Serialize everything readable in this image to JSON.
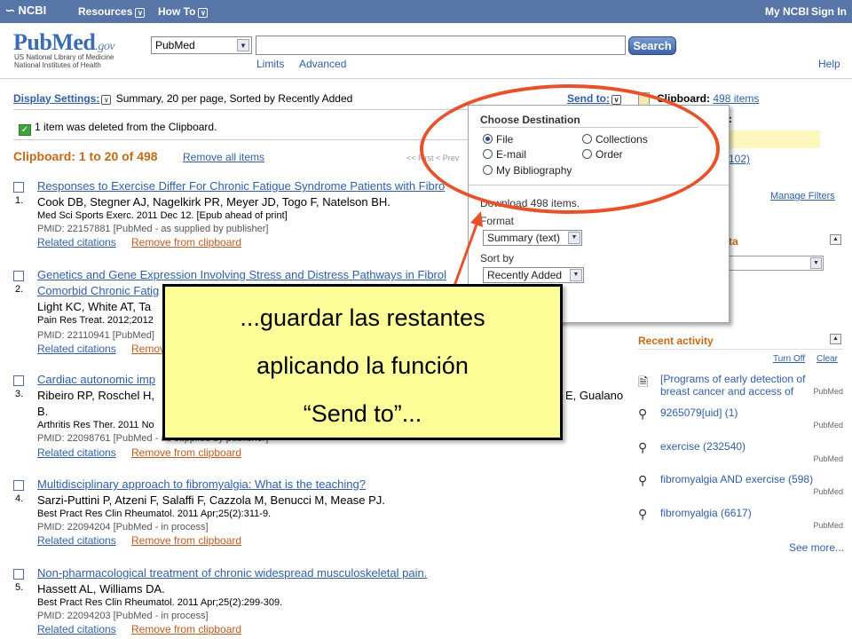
{
  "ncbi_bar": {
    "logo": "NCBI",
    "resources": "Resources",
    "howto": "How To",
    "my_ncbi": "My NCBI",
    "sign_in": "Sign In",
    "bg_color": "#5875a8"
  },
  "header": {
    "logo_main": "PubMed",
    "logo_suffix": ".gov",
    "logo_sub_1": "US National Library of Medicine",
    "logo_sub_2": "National Institutes of Health",
    "database": "PubMed",
    "search_value": "",
    "search_button": "Search",
    "limits": "Limits",
    "advanced": "Advanced",
    "help": "Help"
  },
  "display": {
    "settings_label": "Display Settings:",
    "settings_value": "Summary, 20 per page, Sorted by Recently Added",
    "send_to": "Send to:",
    "deleted_msg": "1 item was deleted from the Clipboard."
  },
  "clipboard": {
    "heading": "Clipboard: 1 to 20 of 498",
    "remove_all": "Remove all items",
    "pager_fragment": "<< First  < Prev"
  },
  "results": [
    {
      "num": "1.",
      "title": "Responses to Exercise Differ For Chronic Fatigue Syndrome Patients with Fibro",
      "authors": "Cook DB, Stegner AJ, Nagelkirk PR, Meyer JD, Togo F, Natelson BH.",
      "source": "Med Sci Sports Exerc. 2011 Dec 12. [Epub ahead of print]",
      "pmid": "PMID: 22157881 [PubMed - as supplied by publisher]",
      "related": "Related citations",
      "remove": "Remove from clipboard"
    },
    {
      "num": "2.",
      "title": "Genetics and Gene Expression Involving Stress and Distress Pathways in Fibrol",
      "title2": "Comorbid Chronic Fatig",
      "authors": "Light KC, White AT, Ta",
      "source": "Pain Res Treat. 2012;2012",
      "pmid": "PMID: 22110941 [PubMed]",
      "related": "Related citations",
      "remove": "Remov"
    },
    {
      "num": "3.",
      "title": "Cardiac autonomic imp",
      "authors": "Ribeiro RP, Roschel H,",
      "authors_tail": "E, Gualano",
      "authors_line2": "B.",
      "source": "Arthritis Res Ther. 2011 No",
      "pmid": "PMID: 22098761 [PubMed - as supplied by publisher]",
      "related": "Related citations",
      "remove": "Remove from clipboard"
    },
    {
      "num": "4.",
      "title": "Multidisciplinary approach to fibromyalgia: What is the teaching?",
      "authors": "Sarzi-Puttini P, Atzeni F, Salaffi F, Cazzola M, Benucci M, Mease PJ.",
      "source": "Best Pract Res Clin Rheumatol. 2011 Apr;25(2):311-9.",
      "pmid": "PMID: 22094204 [PubMed - in process]",
      "related": "Related citations",
      "remove": "Remove from clipboard"
    },
    {
      "num": "5.",
      "title": "Non-pharmacological treatment of chronic widespread musculoskeletal pain.",
      "authors": "Hassett AL, Williams DA.",
      "source": "Best Pract Res Clin Rheumatol. 2011 Apr;25(2):299-309.",
      "pmid": "PMID: 22094203 [PubMed - in process]",
      "related": "Related citations",
      "remove": "Remove from clipboard"
    }
  ],
  "sidebar": {
    "clipboard_label": "Clipboard:",
    "clipboard_count": "498 items",
    "frag_colon": ":",
    "frag_102": "102)",
    "manage_filters": "Manage Filters",
    "frag_ta": "ta",
    "recent_title": "Recent activity",
    "turn_off": "Turn Off",
    "clear": "Clear",
    "activity": [
      {
        "icon": "document-icon",
        "text": "[Programs of early detection of breast cancer and access of",
        "db": "PubMed"
      },
      {
        "icon": "search-icon",
        "text": "9265079[uid] (1)",
        "db": "PubMed"
      },
      {
        "icon": "search-icon",
        "text": "exercise (232540)",
        "db": "PubMed"
      },
      {
        "icon": "search-icon",
        "text": "fibromyalgia AND exercise (598)",
        "db": "PubMed"
      },
      {
        "icon": "search-icon",
        "text": "fibromyalgia (6617)",
        "db": "PubMed"
      }
    ],
    "see_more": "See more..."
  },
  "sendto_panel": {
    "title": "Choose Destination",
    "options": [
      {
        "label": "File",
        "selected": true
      },
      {
        "label": "Collections",
        "selected": false
      },
      {
        "label": "E-mail",
        "selected": false
      },
      {
        "label": "Order",
        "selected": false
      },
      {
        "label": "My Bibliography",
        "selected": false
      }
    ],
    "download_text": "Download 498 items.",
    "format_label": "Format",
    "format_value": "Summary (text)",
    "sortby_label": "Sort by",
    "sortby_value": "Recently Added"
  },
  "callout": {
    "line1": "...guardar las restantes",
    "line2": "aplicando la función",
    "line3": "“Send to”...",
    "ellipse_color": "#e8522b",
    "box_color": "#ffff99"
  }
}
